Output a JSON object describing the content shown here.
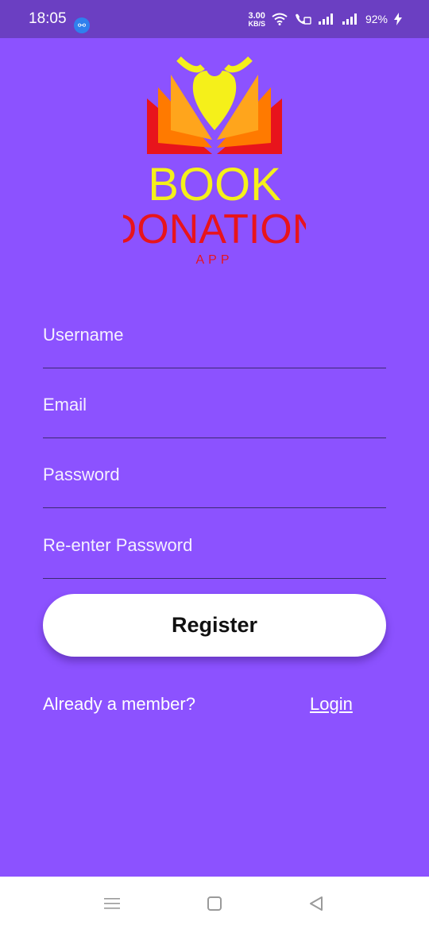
{
  "status_bar": {
    "time": "18:05",
    "net_speed_value": "3.00",
    "net_speed_unit": "KB/S",
    "battery_percent": "92%"
  },
  "logo": {
    "line1": "BOOK",
    "line2": "DONATION",
    "line3": "APP"
  },
  "form": {
    "fields": [
      {
        "label": "Username"
      },
      {
        "label": "Email"
      },
      {
        "label": "Password"
      },
      {
        "label": "Re-enter Password"
      }
    ],
    "register_label": "Register",
    "member_text": "Already a member?",
    "login_label": "Login"
  },
  "icons": {
    "usb": "usb-icon",
    "wifi": "wifi-icon",
    "call": "wifi-call-icon",
    "signal": "signal-icon",
    "battery_bolt": "charging-icon",
    "nav_menu": "menu-icon",
    "nav_home": "home-square-icon",
    "nav_back": "back-triangle-icon"
  },
  "colors": {
    "background": "#8c52ff",
    "status_bar": "#6b3fc2",
    "logo_yellow": "#f5f01a",
    "logo_red": "#e8141c",
    "logo_orange": "#ff7a00"
  }
}
